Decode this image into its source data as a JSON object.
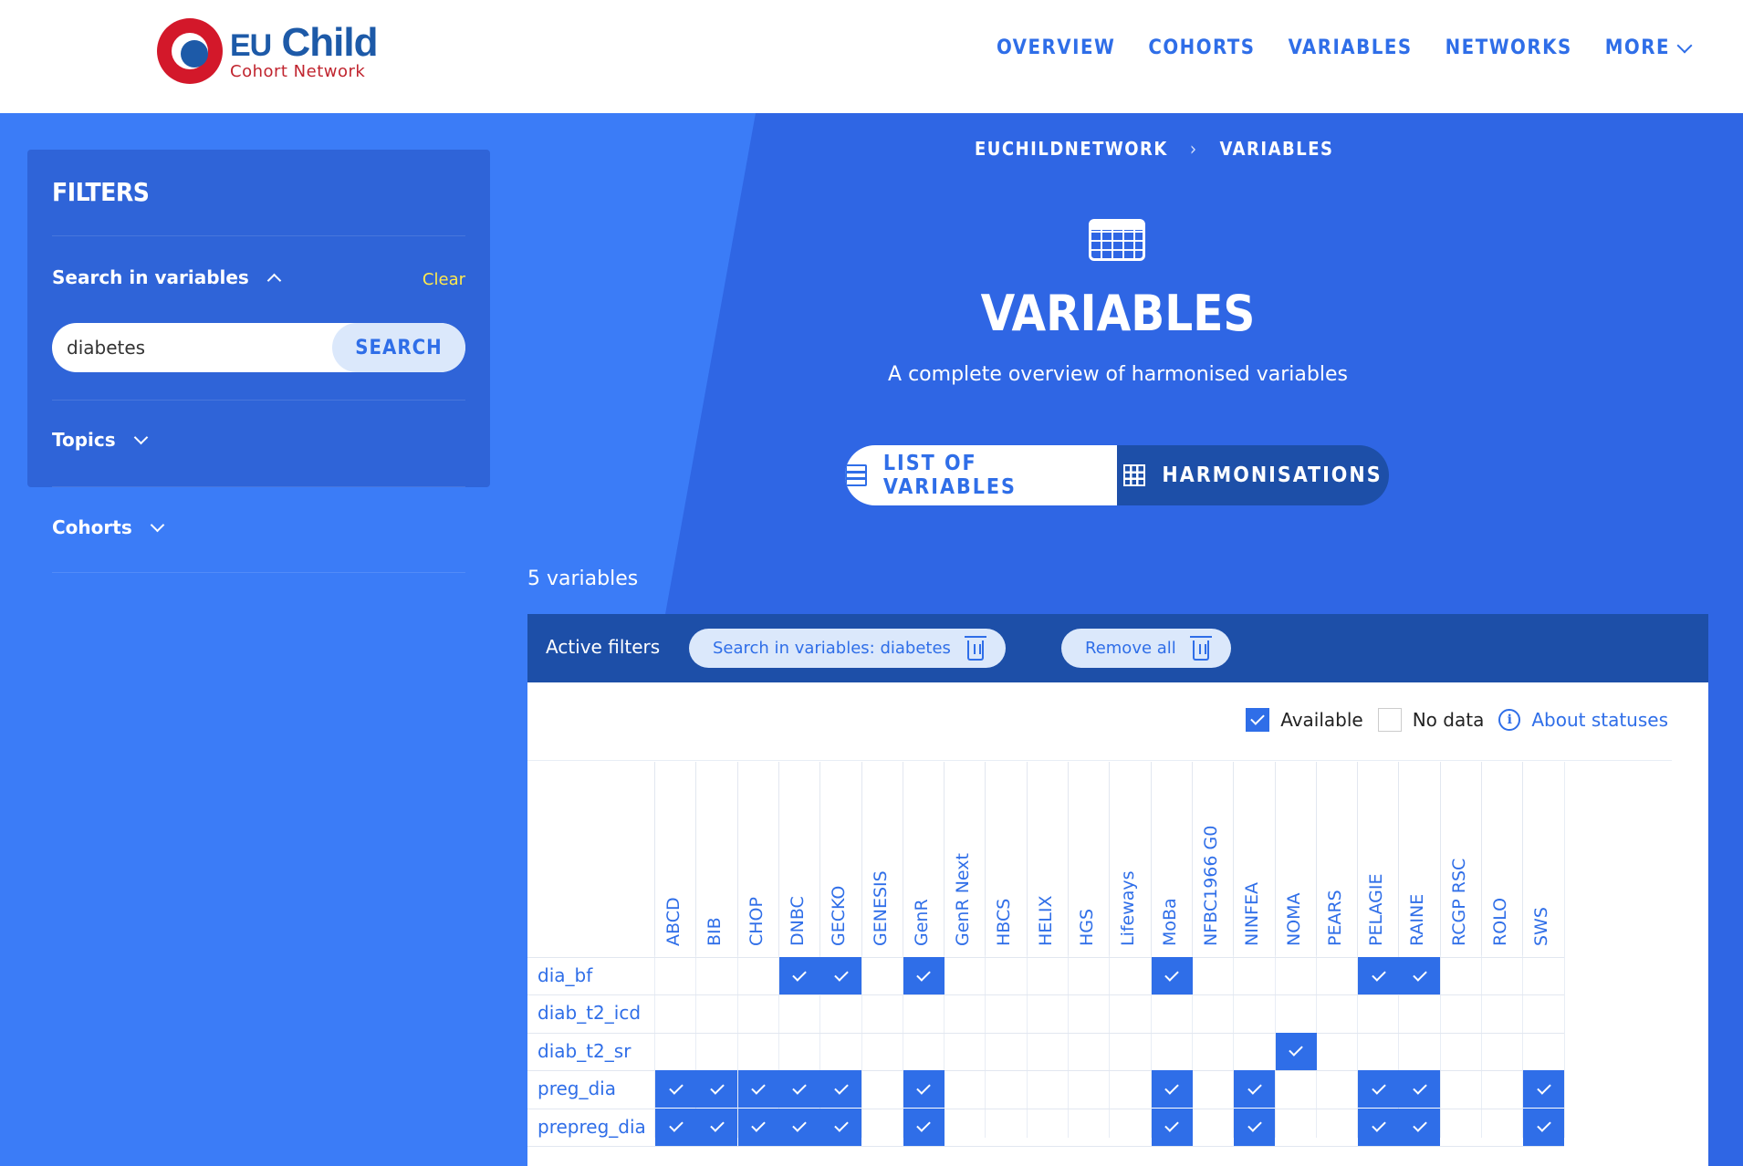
{
  "brand": {
    "eu": "EU",
    "child": "Child",
    "sub": "Cohort Network"
  },
  "nav": [
    "OVERVIEW",
    "COHORTS",
    "VARIABLES",
    "NETWORKS",
    "MORE"
  ],
  "sidebar": {
    "title": "FILTERS",
    "search_label": "Search in variables",
    "clear": "Clear",
    "search_value": "diabetes",
    "search_button": "SEARCH",
    "topics": "Topics",
    "cohorts": "Cohorts"
  },
  "breadcrumb": [
    "EUCHILDNETWORK",
    "VARIABLES"
  ],
  "hero": {
    "title": "VARIABLES",
    "subtitle": "A complete overview of harmonised variables"
  },
  "toggle": {
    "list": "LIST OF VARIABLES",
    "harmonisations": "HARMONISATIONS",
    "active": "harmonisations"
  },
  "count": "5 variables",
  "active_filters": {
    "label": "Active filters",
    "chip": "Search in variables: diabetes",
    "remove_all": "Remove all"
  },
  "legend": {
    "available": "Available",
    "no_data": "No data",
    "about": "About statuses"
  },
  "colors": {
    "accent": "#2f6ee8",
    "dark": "#1d4fa8",
    "bg": "#3b7cf7",
    "clear": "#ffe94d"
  },
  "cohorts": [
    "ABCD",
    "BIB",
    "CHOP",
    "DNBC",
    "GECKO",
    "GENESIS",
    "GenR",
    "GenR Next",
    "HBCS",
    "HELIX",
    "HGS",
    "Lifeways",
    "MoBa",
    "NFBC1966 G0",
    "NINFEA",
    "NOMA",
    "PEARS",
    "PELAGIE",
    "RAINE",
    "RCGP RSC",
    "ROLO",
    "SWS"
  ],
  "variables": [
    {
      "name": "dia_bf",
      "available": [
        "DNBC",
        "GECKO",
        "GenR",
        "MoBa",
        "PELAGIE",
        "RAINE"
      ]
    },
    {
      "name": "diab_t2_icd",
      "available": []
    },
    {
      "name": "diab_t2_sr",
      "available": [
        "NOMA"
      ]
    },
    {
      "name": "preg_dia",
      "available": [
        "ABCD",
        "BIB",
        "CHOP",
        "DNBC",
        "GECKO",
        "GenR",
        "MoBa",
        "NINFEA",
        "PELAGIE",
        "RAINE",
        "SWS"
      ]
    },
    {
      "name": "prepreg_dia",
      "available": [
        "ABCD",
        "BIB",
        "CHOP",
        "DNBC",
        "GECKO",
        "GenR",
        "MoBa",
        "NINFEA",
        "PELAGIE",
        "RAINE",
        "SWS"
      ]
    }
  ]
}
